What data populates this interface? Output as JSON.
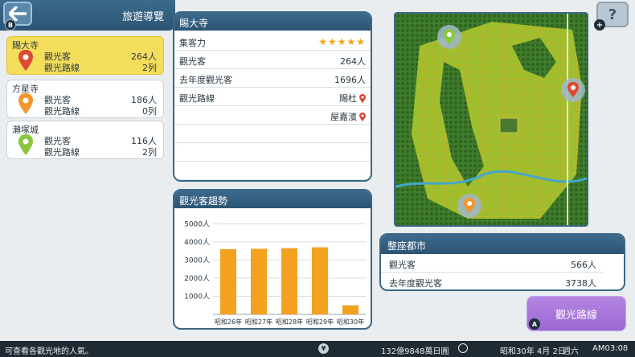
{
  "header": {
    "title": "旅遊導覽",
    "back_badge": "B"
  },
  "spots": [
    {
      "name": "賜大寺",
      "visitors_label": "觀光客",
      "visitors": "264人",
      "routes_label": "觀光路線",
      "routes": "2列",
      "pin_color": "#e04a35",
      "selected": true
    },
    {
      "name": "方星寺",
      "visitors_label": "觀光客",
      "visitors": "186人",
      "routes_label": "觀光路線",
      "routes": "0列",
      "pin_color": "#f2952d",
      "selected": false
    },
    {
      "name": "瀨塚城",
      "visitors_label": "觀光客",
      "visitors": "116人",
      "routes_label": "觀光路線",
      "routes": "2列",
      "pin_color": "#8cc63f",
      "selected": false
    }
  ],
  "info": {
    "title": "賜大寺",
    "attraction_label": "集客力",
    "stars": "★★★★★",
    "visitors_label": "觀光客",
    "visitors": "264人",
    "last_year_label": "去年度觀光客",
    "last_year": "1696人",
    "routes_label": "觀光路線",
    "route_1": "賜杜",
    "route_2": "屋嘉濱"
  },
  "trend": {
    "title": "觀光客趨勢"
  },
  "chart_data": {
    "type": "bar",
    "categories": [
      "昭和26年",
      "昭和27年",
      "昭和28年",
      "昭和29年",
      "昭和30年"
    ],
    "values": [
      3600,
      3620,
      3650,
      3700,
      500
    ],
    "ylim": [
      0,
      5500
    ],
    "yticks": [
      1000,
      2000,
      3000,
      4000,
      5000
    ],
    "ytick_labels": [
      "1000人",
      "2000人",
      "3000人",
      "4000人",
      "5000人"
    ],
    "bar_color": "#f3a21f",
    "grid": true
  },
  "city": {
    "title": "整座都市",
    "visitors_label": "觀光客",
    "visitors": "566人",
    "last_year_label": "去年度觀光客",
    "last_year": "3738人"
  },
  "route_button": {
    "label": "觀光路線",
    "badge": "A"
  },
  "help": {
    "label": "?",
    "plus": "+"
  },
  "footer": {
    "hint": "可查看各觀光地的人氣。",
    "money": "132億9848萬日圓",
    "date": "昭和30年 4月 2日",
    "weekday": "週六",
    "time": "AM03:08"
  }
}
